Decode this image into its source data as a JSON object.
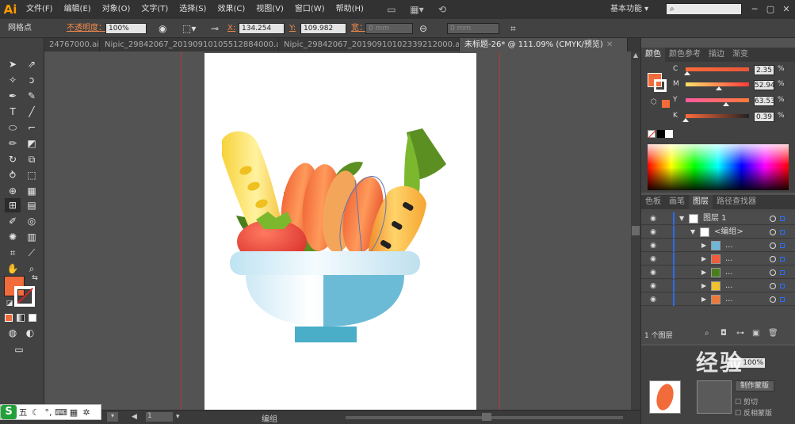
{
  "app": {
    "logo": "Ai"
  },
  "menu": [
    "文件(F)",
    "编辑(E)",
    "对象(O)",
    "文字(T)",
    "选择(S)",
    "效果(C)",
    "视图(V)",
    "窗口(W)",
    "帮助(H)"
  ],
  "workspace": "基本功能",
  "control": {
    "selection_label": "网格点",
    "opacity_label": "不透明度：",
    "opacity_value": "100%",
    "x_label": "X:",
    "x_value": "134.254",
    "y_label": "Y:",
    "y_value": "109.982",
    "width_label": "宽：",
    "width_value": "0 mm",
    "height_value": "0 mm"
  },
  "doc_tabs": [
    {
      "label": "24767000.ai*"
    },
    {
      "label": "Nipic_29842067_20190910105512884000.ai*"
    },
    {
      "label": "Nipic_29842067_20190910102339212000.ai*"
    },
    {
      "label": "未标题-26* @ 111.09% (CMYK/预览)",
      "active": true
    }
  ],
  "color_panel": {
    "tabs": [
      "颜色",
      "颜色参考",
      "描边",
      "渐变"
    ],
    "channels": [
      {
        "letter": "C",
        "value": "2.35",
        "fraction": 0.0235,
        "grad": [
          "#ff6a3a",
          "#e8563a"
        ]
      },
      {
        "letter": "M",
        "value": "52.94",
        "fraction": 0.5294,
        "grad": [
          "#ffe06a",
          "#ff3a3a"
        ]
      },
      {
        "letter": "Y",
        "value": "63.53",
        "fraction": 0.6353,
        "grad": [
          "#ff5aa0",
          "#ff7a3a"
        ]
      },
      {
        "letter": "K",
        "value": "0.39",
        "fraction": 0.0039,
        "grad": [
          "#ff6a3a",
          "#222222"
        ]
      }
    ],
    "pct": "%"
  },
  "layers_panel": {
    "tabs": [
      "色板",
      "画笔",
      "图层",
      "路径查找器"
    ],
    "rows": [
      {
        "name": "图层 1",
        "level": 0,
        "tri": "▼"
      },
      {
        "name": "<编组>",
        "level": 1,
        "tri": "▼"
      },
      {
        "name": "...",
        "level": 2,
        "tri": "▶",
        "thumb": "#6fb7d8"
      },
      {
        "name": "...",
        "level": 2,
        "tri": "▶",
        "thumb": "#f25b3a"
      },
      {
        "name": "...",
        "level": 2,
        "tri": "▶",
        "thumb": "#4a7d1e"
      },
      {
        "name": "...",
        "level": 2,
        "tri": "▶",
        "thumb": "#f0c230"
      },
      {
        "name": "...",
        "level": 2,
        "tri": "▶",
        "thumb": "#ee7a3a"
      }
    ],
    "footer_count": "1 个图层"
  },
  "lower_panel": {
    "mask_button": "制作蒙版",
    "clip_label": "剪切",
    "invert_label": "反相蒙版",
    "zoom_value": "100%"
  },
  "status": {
    "zoom": "111.09%",
    "page": "1",
    "mode": "编组"
  },
  "ime": {
    "logo": "S",
    "label": "五"
  },
  "watermark": "经验",
  "colors": {
    "fill": "#f26b3a",
    "accent": "#2a6dff",
    "guide": "#b33838"
  }
}
